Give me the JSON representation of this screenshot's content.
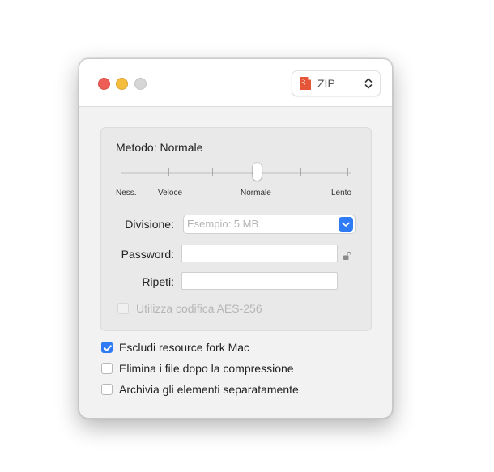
{
  "format": {
    "label": "ZIP"
  },
  "method": {
    "title": "Metodo: Normale",
    "ticks": [
      "Ness.",
      "Veloce",
      "Normale",
      "Lento"
    ],
    "level_index": 3,
    "level_count": 6
  },
  "fields": {
    "division_label": "Divisione:",
    "division_placeholder": "Esempio: 5 MB",
    "password_label": "Password:",
    "password_value": "",
    "repeat_label": "Ripeti:",
    "repeat_value": ""
  },
  "encryption": {
    "label": "Utilizza codifica AES-256",
    "checked": false,
    "enabled": false
  },
  "options": [
    {
      "label": "Escludi resource fork Mac",
      "checked": true
    },
    {
      "label": "Elimina i file dopo la compressione",
      "checked": false
    },
    {
      "label": "Archivia gli elementi separatamente",
      "checked": false
    }
  ],
  "colors": {
    "accent": "#2f7bf5",
    "close": "#ee5d56",
    "minimize": "#f4bd3e"
  }
}
